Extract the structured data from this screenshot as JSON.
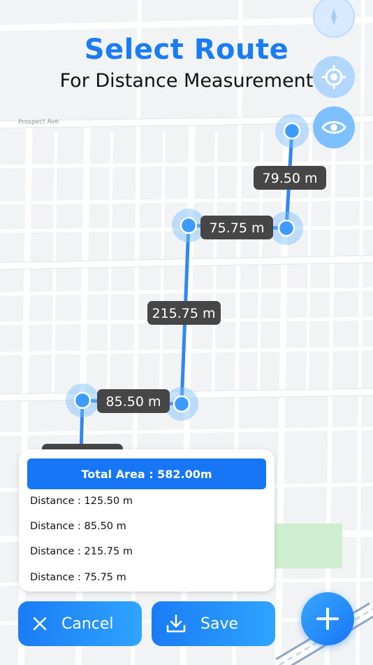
{
  "header": {
    "title": "Select Route",
    "subtitle": "For Distance Measurement"
  },
  "map": {
    "street_label": "Prospect Ave",
    "route_labels": [
      "79.50 m",
      "75.75 m",
      "215.75 m",
      "85.50 m"
    ],
    "colors": {
      "route": "#2f86f6",
      "label_bg": "#464646",
      "park": "#cfeecf"
    }
  },
  "side_buttons": {
    "compass_icon": "compass-icon",
    "locate_icon": "crosshair-icon",
    "visibility_icon": "eye-icon"
  },
  "summary": {
    "total_label": "Total Area : 582.00m",
    "distances": [
      "Distance : 125.50 m",
      "Distance : 85.50 m",
      "Distance : 215.75 m",
      "Distance : 75.75 m"
    ]
  },
  "actions": {
    "cancel_label": "Cancel",
    "save_label": "Save",
    "add_icon": "plus-icon"
  },
  "colors": {
    "accent": "#1a7cf5",
    "accent_light": "#2ea4ff"
  }
}
